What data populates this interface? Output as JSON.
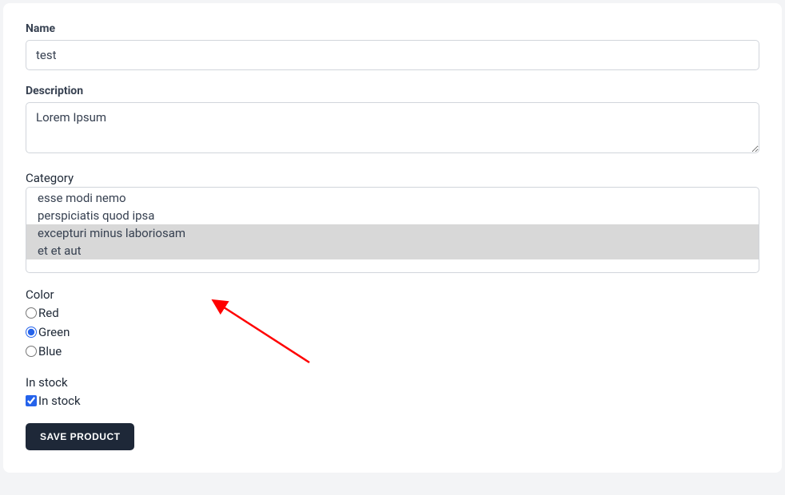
{
  "form": {
    "name": {
      "label": "Name",
      "value": "test"
    },
    "description": {
      "label": "Description",
      "value": "Lorem Ipsum"
    },
    "category": {
      "label": "Category",
      "options": [
        {
          "label": "esse modi nemo",
          "selected": false
        },
        {
          "label": "perspiciatis quod ipsa",
          "selected": false
        },
        {
          "label": "excepturi minus laboriosam",
          "selected": true
        },
        {
          "label": "et et aut",
          "selected": true
        }
      ]
    },
    "color": {
      "label": "Color",
      "options": [
        {
          "label": "Red",
          "checked": false
        },
        {
          "label": "Green",
          "checked": true
        },
        {
          "label": "Blue",
          "checked": false
        }
      ]
    },
    "in_stock": {
      "label": "In stock",
      "checkbox_label": "In stock",
      "checked": true
    },
    "submit_label": "SAVE PRODUCT"
  },
  "annotation": {
    "type": "arrow",
    "color": "#ff0000"
  }
}
